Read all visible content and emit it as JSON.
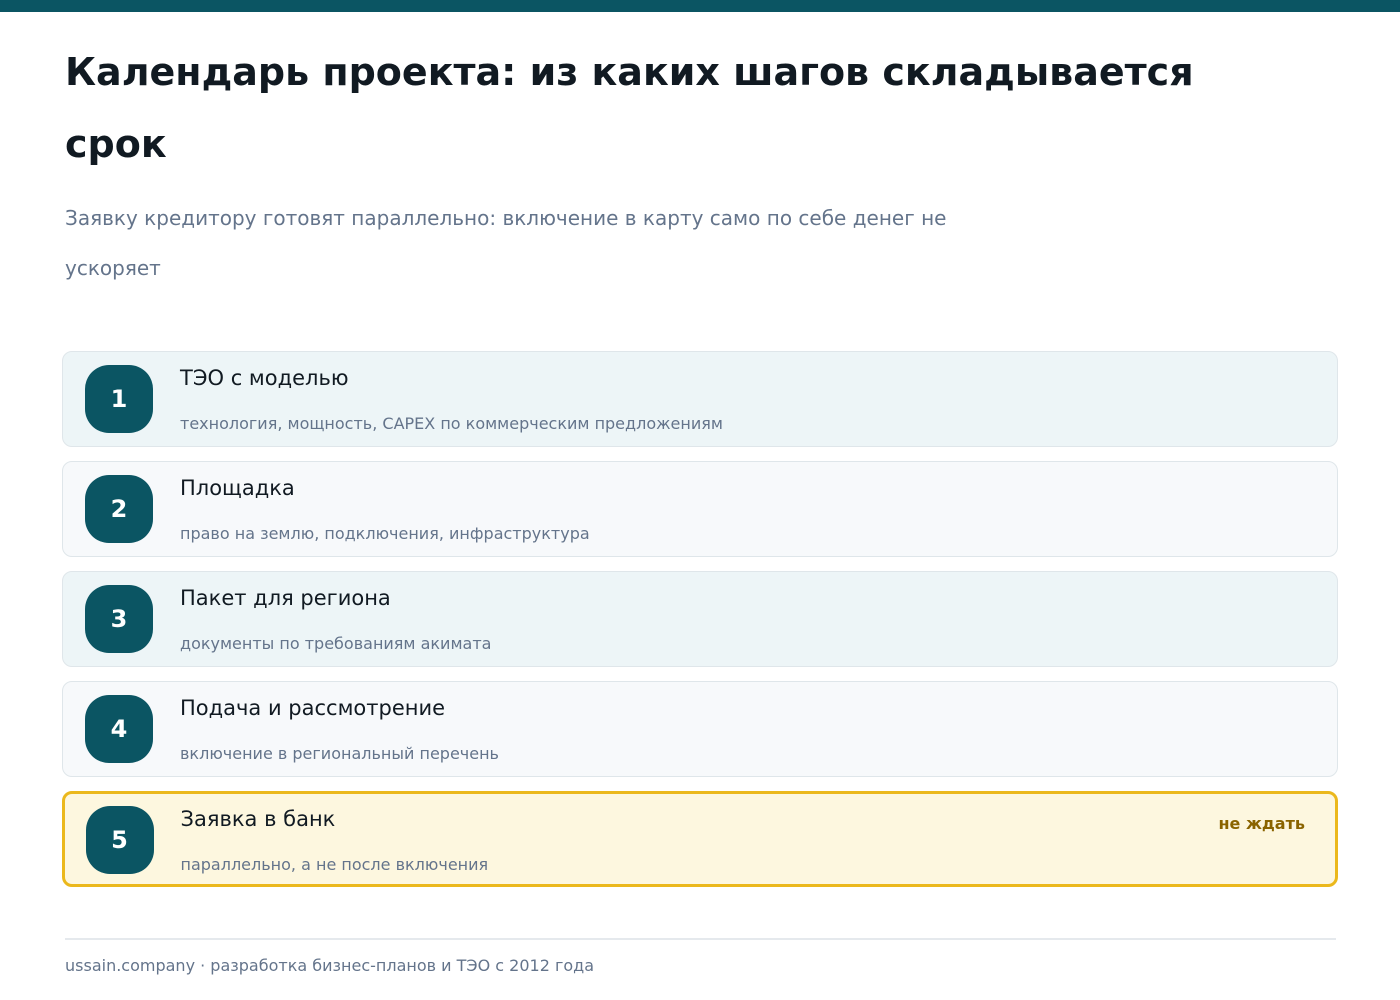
{
  "header": {
    "title": "Календарь проекта: из каких шагов складывается срок",
    "subtitle": "Заявку кредитору готовят параллельно: включение в карту само по себе денег не ускоряет"
  },
  "colors": {
    "accent": "#0b5563",
    "highlight_border": "#ebb81c",
    "highlight_background": "#fdf7df",
    "tag_text": "#8a6400"
  },
  "steps": [
    {
      "number": "1",
      "title": "ТЭО с моделью",
      "description": "технология, мощность, CAPEX по коммерческим предложениям",
      "tag": ""
    },
    {
      "number": "2",
      "title": "Площадка",
      "description": "право на землю, подключения, инфраструктура",
      "tag": ""
    },
    {
      "number": "3",
      "title": "Пакет для региона",
      "description": "документы по требованиям акимата",
      "tag": ""
    },
    {
      "number": "4",
      "title": "Подача и рассмотрение",
      "description": "включение в региональный перечень",
      "tag": ""
    },
    {
      "number": "5",
      "title": "Заявка в банк",
      "description": "параллельно, а не после включения",
      "tag": "не ждать"
    }
  ],
  "footer": {
    "text": "ussain.company · разработка бизнес-планов и ТЭО с 2012 года"
  }
}
